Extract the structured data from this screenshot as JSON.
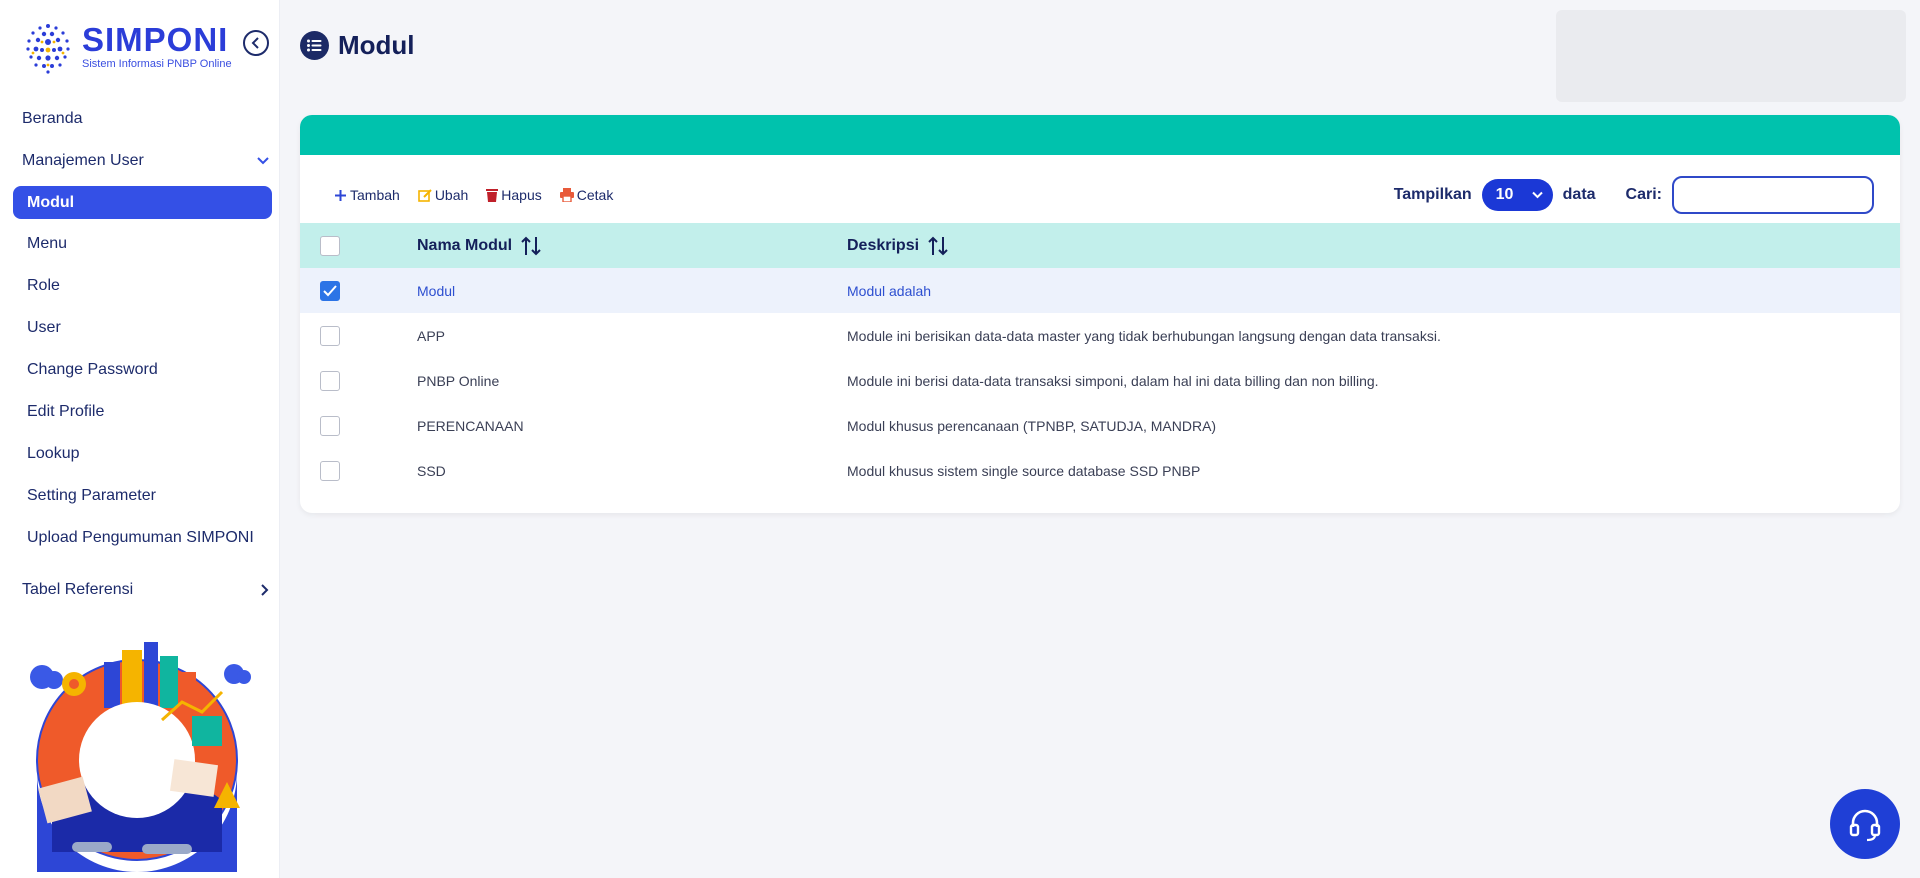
{
  "brand": {
    "title": "SIMPONI",
    "subtitle": "Sistem Informasi PNBP Online"
  },
  "sidebar": {
    "items": [
      {
        "label": "Beranda"
      },
      {
        "label": "Manajemen User"
      },
      {
        "label": "Modul"
      },
      {
        "label": "Menu"
      },
      {
        "label": "Role"
      },
      {
        "label": "User"
      },
      {
        "label": "Change Password"
      },
      {
        "label": "Edit Profile"
      },
      {
        "label": "Lookup"
      },
      {
        "label": "Setting Parameter"
      },
      {
        "label": "Upload Pengumuman SIMPONI"
      },
      {
        "label": "Tabel Referensi"
      }
    ]
  },
  "header": {
    "title": "Modul"
  },
  "toolbar": {
    "add_label": "Tambah",
    "edit_label": "Ubah",
    "delete_label": "Hapus",
    "print_label": "Cetak",
    "show_label": "Tampilkan",
    "page_size": "10",
    "data_label": "data",
    "search_label": "Cari:",
    "search_value": ""
  },
  "table": {
    "columns": [
      "Nama Modul",
      "Deskripsi"
    ],
    "rows": [
      {
        "name": "Modul",
        "description": "Modul adalah",
        "checked": true
      },
      {
        "name": "APP",
        "description": "Module ini berisikan data-data master yang tidak berhubungan langsung dengan data transaksi.",
        "checked": false
      },
      {
        "name": "PNBP Online",
        "description": "Module ini berisi data-data transaksi simponi, dalam hal ini data billing dan non billing.",
        "checked": false
      },
      {
        "name": "PERENCANAAN",
        "description": "Modul khusus perencanaan (TPNBP, SATUDJA, MANDRA)",
        "checked": false
      },
      {
        "name": "SSD",
        "description": "Modul khusus sistem single source database SSD PNBP",
        "checked": false
      }
    ]
  },
  "colors": {
    "accent": "#3450e6",
    "header_bar": "#00c2ad",
    "table_header": "#c2efeb",
    "navy": "#1d2b6b"
  },
  "icons": {
    "collapse": "chevron-left-circle-icon",
    "title": "list-icon",
    "add": "plus-icon",
    "edit": "edit-icon",
    "delete": "trash-icon",
    "print": "printer-icon",
    "sort": "sort-icon",
    "help": "headset-icon"
  }
}
